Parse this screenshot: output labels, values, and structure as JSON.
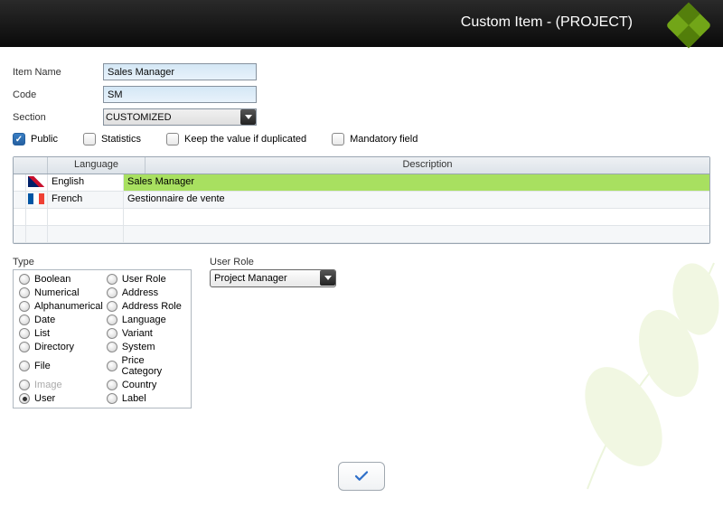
{
  "header": {
    "title": "Custom Item - (PROJECT)"
  },
  "fields": {
    "itemName": {
      "label": "Item Name",
      "value": "Sales Manager"
    },
    "code": {
      "label": "Code",
      "value": "SM"
    },
    "section": {
      "label": "Section",
      "value": "CUSTOMIZED"
    }
  },
  "checks": {
    "public": {
      "label": "Public",
      "checked": true
    },
    "statistics": {
      "label": "Statistics",
      "checked": false
    },
    "keepValue": {
      "label": "Keep the value if duplicated",
      "checked": false
    },
    "mandatory": {
      "label": "Mandatory field",
      "checked": false
    }
  },
  "table": {
    "headers": {
      "language": "Language",
      "description": "Description"
    },
    "rows": [
      {
        "lang": "English",
        "desc": "Sales Manager",
        "flag": "en",
        "highlight": true
      },
      {
        "lang": "French",
        "desc": "Gestionnaire de vente",
        "flag": "fr",
        "highlight": false
      }
    ]
  },
  "type": {
    "label": "Type",
    "options": [
      {
        "label": "Boolean"
      },
      {
        "label": "User Role"
      },
      {
        "label": "Numerical"
      },
      {
        "label": "Address"
      },
      {
        "label": "Alphanumerical"
      },
      {
        "label": "Address Role"
      },
      {
        "label": "Date"
      },
      {
        "label": "Language"
      },
      {
        "label": "List"
      },
      {
        "label": "Variant"
      },
      {
        "label": "Directory"
      },
      {
        "label": "System"
      },
      {
        "label": "File"
      },
      {
        "label": "Price Category"
      },
      {
        "label": "Image",
        "disabled": true
      },
      {
        "label": "Country"
      },
      {
        "label": "User",
        "selected": true
      },
      {
        "label": "Label"
      }
    ]
  },
  "userRole": {
    "label": "User Role",
    "value": "Project Manager"
  }
}
